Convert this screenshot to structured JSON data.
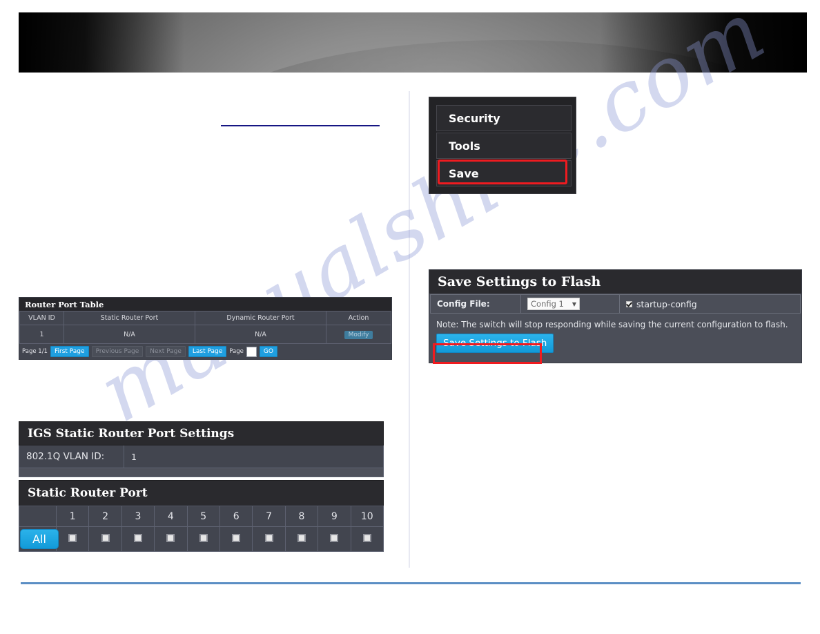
{
  "watermark": {
    "text": "manualshive.com"
  },
  "banner": {
    "name": "product-banner-image"
  },
  "router_port_table": {
    "title": "Router Port Table",
    "columns": [
      "VLAN ID",
      "Static Router Port",
      "Dynamic Router Port",
      "Action"
    ],
    "rows": [
      {
        "vlan_id": "1",
        "static_router_port": "N/A",
        "dynamic_router_port": "N/A",
        "action_label": "Modify"
      }
    ],
    "pager": {
      "page_status": "Page 1/1",
      "first_page": "First Page",
      "previous_page": "Previous Page",
      "next_page": "Next Page",
      "last_page": "Last Page",
      "page_label": "Page",
      "page_value": "",
      "go": "GO"
    }
  },
  "igs_settings": {
    "title": "IGS Static Router Port Settings",
    "vlan_label": "802.1Q VLAN ID:",
    "vlan_value": "1"
  },
  "static_router_port": {
    "title": "Static Router Port",
    "all_label": "All",
    "ports": [
      "1",
      "2",
      "3",
      "4",
      "5",
      "6",
      "7",
      "8",
      "9",
      "10"
    ],
    "checked": [
      false,
      false,
      false,
      false,
      false,
      false,
      false,
      false,
      false,
      false
    ]
  },
  "side_menu": {
    "items": [
      {
        "label": "Security",
        "highlighted": false
      },
      {
        "label": "Tools",
        "highlighted": false
      },
      {
        "label": "Save",
        "highlighted": true
      }
    ]
  },
  "flash_panel": {
    "title": "Save Settings to Flash",
    "config_file_label": "Config File:",
    "config_file_value": "Config 1",
    "caret_icon": "chevron-down-icon",
    "startup_config_label": "startup-config",
    "startup_config_checked": true,
    "note": "Note: The switch will stop responding while saving the current configuration to flash.",
    "save_button_label": "Save Settings to Flash"
  },
  "colors": {
    "highlight_red": "#ef1b20",
    "accent_blue": "#1f9fe0",
    "panel_dark": "#2a2a2e",
    "panel_body": "#42454f",
    "rule_navy": "#161683",
    "rule_blue": "#5b8ec4"
  }
}
